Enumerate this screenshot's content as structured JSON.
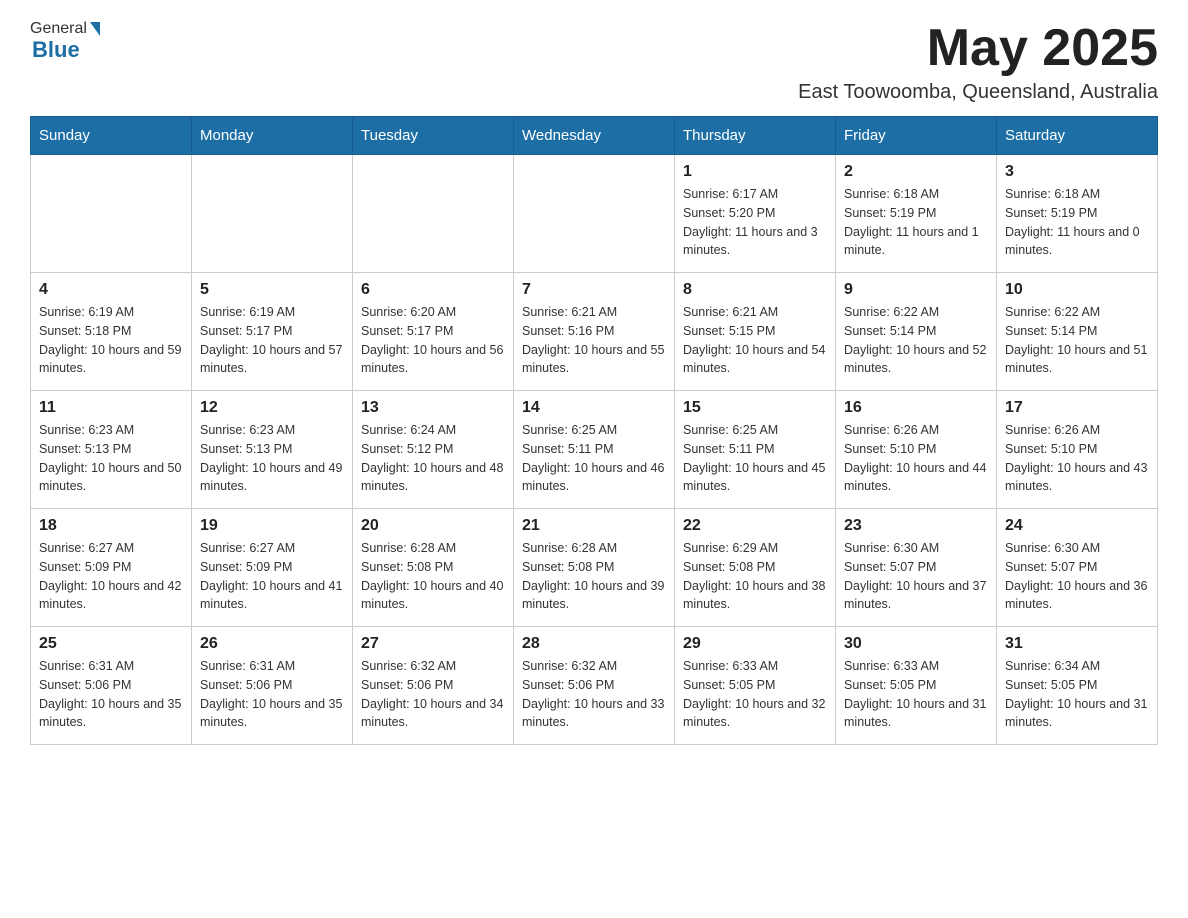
{
  "header": {
    "logo_general": "General",
    "logo_blue": "Blue",
    "month_year": "May 2025",
    "location": "East Toowoomba, Queensland, Australia"
  },
  "calendar": {
    "days_of_week": [
      "Sunday",
      "Monday",
      "Tuesday",
      "Wednesday",
      "Thursday",
      "Friday",
      "Saturday"
    ],
    "weeks": [
      [
        {
          "day": "",
          "info": ""
        },
        {
          "day": "",
          "info": ""
        },
        {
          "day": "",
          "info": ""
        },
        {
          "day": "",
          "info": ""
        },
        {
          "day": "1",
          "info": "Sunrise: 6:17 AM\nSunset: 5:20 PM\nDaylight: 11 hours and 3 minutes."
        },
        {
          "day": "2",
          "info": "Sunrise: 6:18 AM\nSunset: 5:19 PM\nDaylight: 11 hours and 1 minute."
        },
        {
          "day": "3",
          "info": "Sunrise: 6:18 AM\nSunset: 5:19 PM\nDaylight: 11 hours and 0 minutes."
        }
      ],
      [
        {
          "day": "4",
          "info": "Sunrise: 6:19 AM\nSunset: 5:18 PM\nDaylight: 10 hours and 59 minutes."
        },
        {
          "day": "5",
          "info": "Sunrise: 6:19 AM\nSunset: 5:17 PM\nDaylight: 10 hours and 57 minutes."
        },
        {
          "day": "6",
          "info": "Sunrise: 6:20 AM\nSunset: 5:17 PM\nDaylight: 10 hours and 56 minutes."
        },
        {
          "day": "7",
          "info": "Sunrise: 6:21 AM\nSunset: 5:16 PM\nDaylight: 10 hours and 55 minutes."
        },
        {
          "day": "8",
          "info": "Sunrise: 6:21 AM\nSunset: 5:15 PM\nDaylight: 10 hours and 54 minutes."
        },
        {
          "day": "9",
          "info": "Sunrise: 6:22 AM\nSunset: 5:14 PM\nDaylight: 10 hours and 52 minutes."
        },
        {
          "day": "10",
          "info": "Sunrise: 6:22 AM\nSunset: 5:14 PM\nDaylight: 10 hours and 51 minutes."
        }
      ],
      [
        {
          "day": "11",
          "info": "Sunrise: 6:23 AM\nSunset: 5:13 PM\nDaylight: 10 hours and 50 minutes."
        },
        {
          "day": "12",
          "info": "Sunrise: 6:23 AM\nSunset: 5:13 PM\nDaylight: 10 hours and 49 minutes."
        },
        {
          "day": "13",
          "info": "Sunrise: 6:24 AM\nSunset: 5:12 PM\nDaylight: 10 hours and 48 minutes."
        },
        {
          "day": "14",
          "info": "Sunrise: 6:25 AM\nSunset: 5:11 PM\nDaylight: 10 hours and 46 minutes."
        },
        {
          "day": "15",
          "info": "Sunrise: 6:25 AM\nSunset: 5:11 PM\nDaylight: 10 hours and 45 minutes."
        },
        {
          "day": "16",
          "info": "Sunrise: 6:26 AM\nSunset: 5:10 PM\nDaylight: 10 hours and 44 minutes."
        },
        {
          "day": "17",
          "info": "Sunrise: 6:26 AM\nSunset: 5:10 PM\nDaylight: 10 hours and 43 minutes."
        }
      ],
      [
        {
          "day": "18",
          "info": "Sunrise: 6:27 AM\nSunset: 5:09 PM\nDaylight: 10 hours and 42 minutes."
        },
        {
          "day": "19",
          "info": "Sunrise: 6:27 AM\nSunset: 5:09 PM\nDaylight: 10 hours and 41 minutes."
        },
        {
          "day": "20",
          "info": "Sunrise: 6:28 AM\nSunset: 5:08 PM\nDaylight: 10 hours and 40 minutes."
        },
        {
          "day": "21",
          "info": "Sunrise: 6:28 AM\nSunset: 5:08 PM\nDaylight: 10 hours and 39 minutes."
        },
        {
          "day": "22",
          "info": "Sunrise: 6:29 AM\nSunset: 5:08 PM\nDaylight: 10 hours and 38 minutes."
        },
        {
          "day": "23",
          "info": "Sunrise: 6:30 AM\nSunset: 5:07 PM\nDaylight: 10 hours and 37 minutes."
        },
        {
          "day": "24",
          "info": "Sunrise: 6:30 AM\nSunset: 5:07 PM\nDaylight: 10 hours and 36 minutes."
        }
      ],
      [
        {
          "day": "25",
          "info": "Sunrise: 6:31 AM\nSunset: 5:06 PM\nDaylight: 10 hours and 35 minutes."
        },
        {
          "day": "26",
          "info": "Sunrise: 6:31 AM\nSunset: 5:06 PM\nDaylight: 10 hours and 35 minutes."
        },
        {
          "day": "27",
          "info": "Sunrise: 6:32 AM\nSunset: 5:06 PM\nDaylight: 10 hours and 34 minutes."
        },
        {
          "day": "28",
          "info": "Sunrise: 6:32 AM\nSunset: 5:06 PM\nDaylight: 10 hours and 33 minutes."
        },
        {
          "day": "29",
          "info": "Sunrise: 6:33 AM\nSunset: 5:05 PM\nDaylight: 10 hours and 32 minutes."
        },
        {
          "day": "30",
          "info": "Sunrise: 6:33 AM\nSunset: 5:05 PM\nDaylight: 10 hours and 31 minutes."
        },
        {
          "day": "31",
          "info": "Sunrise: 6:34 AM\nSunset: 5:05 PM\nDaylight: 10 hours and 31 minutes."
        }
      ]
    ]
  }
}
